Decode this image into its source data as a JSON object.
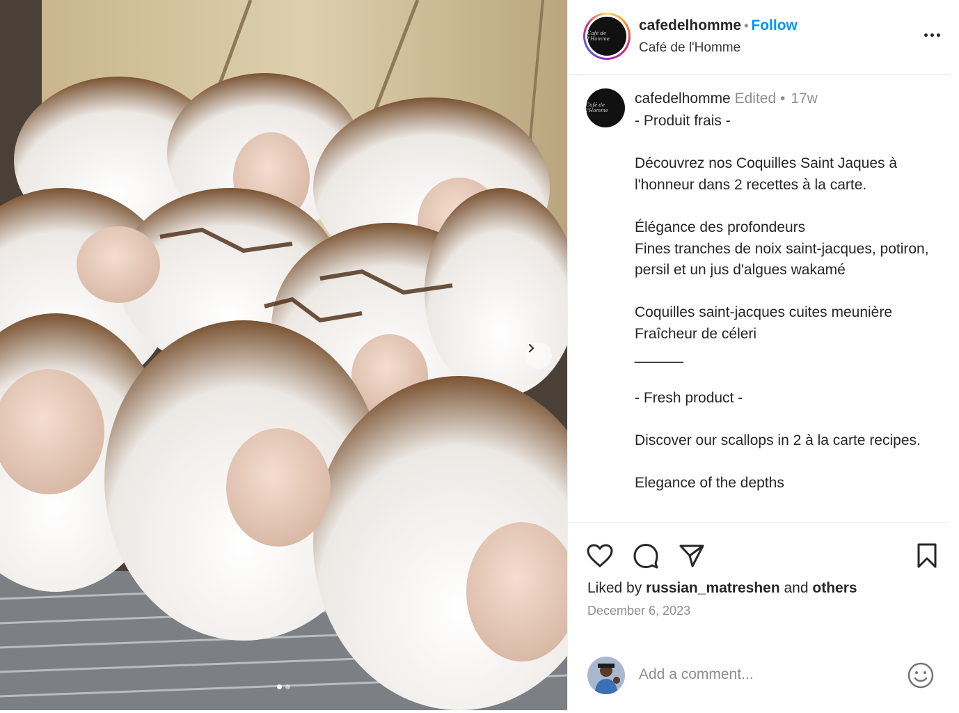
{
  "post": {
    "author": {
      "username": "cafedelhomme",
      "display_name": "Café de l'Homme",
      "logo_text": "Café de l'Homme",
      "follow_label": "Follow"
    },
    "header_separator": "•",
    "caption": {
      "username": "cafedelhomme",
      "edited_label": "Edited •",
      "time_ago": "17w",
      "lines": [
        "- Produit frais -",
        "",
        "Découvrez nos Coquilles Saint Jaques à l'honneur dans 2 recettes à la carte.",
        "",
        "Élégance des profondeurs",
        "Fines tranches de noix saint-jacques, potiron, persil et un jus d'algues wakamé",
        "",
        "Coquilles saint-jacques cuites meunière",
        "Fraîcheur de céleri",
        "______",
        "",
        "- Fresh product -",
        "",
        "Discover our scallops in 2 à la carte recipes.",
        "",
        "Elegance of the depths"
      ]
    },
    "likes": {
      "prefix": "Liked by",
      "user": "russian_matreshen",
      "conjunction": "and",
      "others": "others"
    },
    "date": "December 6, 2023",
    "comment": {
      "placeholder": "Add a comment..."
    },
    "carousel": {
      "slide_count": 2,
      "active_slide": 1
    },
    "icons": {
      "more": "more-options-icon",
      "like": "heart-icon",
      "comment": "comment-icon",
      "share": "share-icon",
      "save": "bookmark-icon",
      "next": "chevron-right-icon",
      "emoji": "emoji-icon"
    },
    "colors": {
      "follow": "#0095f6",
      "secondary_text": "#8e8e8e",
      "primary_text": "#262626"
    }
  }
}
